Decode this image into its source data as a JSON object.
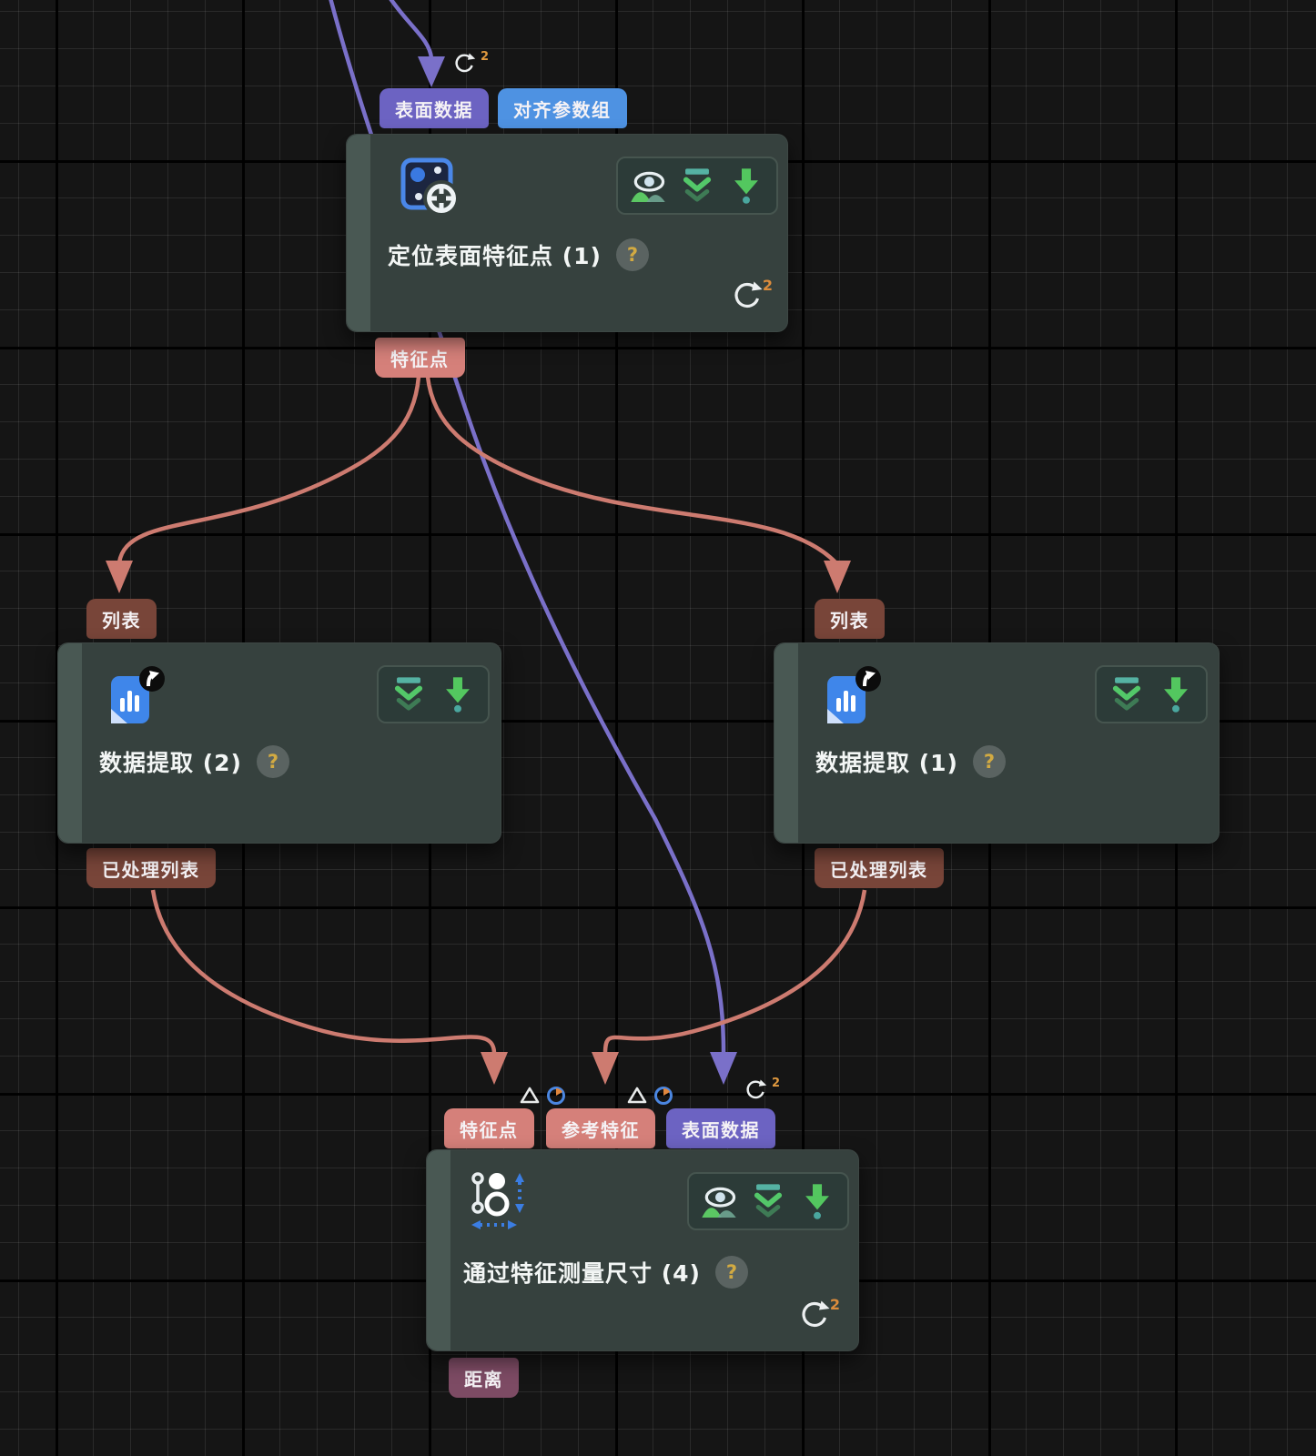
{
  "graph": {
    "colors": {
      "tab_purple": "#6c63c2",
      "tab_blue": "#4e92e2",
      "tab_salmon": "#d5807a",
      "tab_brick": "#784539",
      "tab_plum": "#7d4b64",
      "edge_purple": "#7a70c9",
      "edge_salmon": "#cd7b70",
      "node_bg": "#36413e"
    },
    "nodes": [
      {
        "title": "定位表面特征点 (1)",
        "help": "?",
        "loop_count": "2",
        "inputs": [
          {
            "label": "表面数据",
            "badge_count": "2"
          },
          {
            "label": "对齐参数组"
          }
        ],
        "outputs": [
          {
            "label": "特征点"
          }
        ]
      },
      {
        "title": "数据提取 (2)",
        "help": "?",
        "inputs": [
          {
            "label": "列表"
          }
        ],
        "outputs": [
          {
            "label": "已处理列表"
          }
        ]
      },
      {
        "title": "数据提取 (1)",
        "help": "?",
        "inputs": [
          {
            "label": "列表"
          }
        ],
        "outputs": [
          {
            "label": "已处理列表"
          }
        ]
      },
      {
        "title": "通过特征测量尺寸 (4)",
        "help": "?",
        "loop_count": "2",
        "inputs": [
          {
            "label": "特征点"
          },
          {
            "label": "参考特征"
          },
          {
            "label": "表面数据",
            "badge_count": "2"
          }
        ],
        "outputs": [
          {
            "label": "距离"
          }
        ]
      }
    ],
    "edges": [
      {
        "from": "offscreen-top",
        "to": "定位表面特征点 (1) / 表面数据",
        "color": "purple"
      },
      {
        "from": "offscreen-top",
        "to": "通过特征测量尺寸 (4) / 表面数据",
        "color": "purple"
      },
      {
        "from": "定位表面特征点 (1) / 特征点",
        "to": "数据提取 (2) / 列表",
        "color": "salmon"
      },
      {
        "from": "定位表面特征点 (1) / 特征点",
        "to": "数据提取 (1) / 列表",
        "color": "salmon"
      },
      {
        "from": "数据提取 (2) / 已处理列表",
        "to": "通过特征测量尺寸 (4) / 特征点",
        "color": "salmon"
      },
      {
        "from": "数据提取 (1) / 已处理列表",
        "to": "通过特征测量尺寸 (4) / 参考特征",
        "color": "salmon"
      }
    ]
  }
}
